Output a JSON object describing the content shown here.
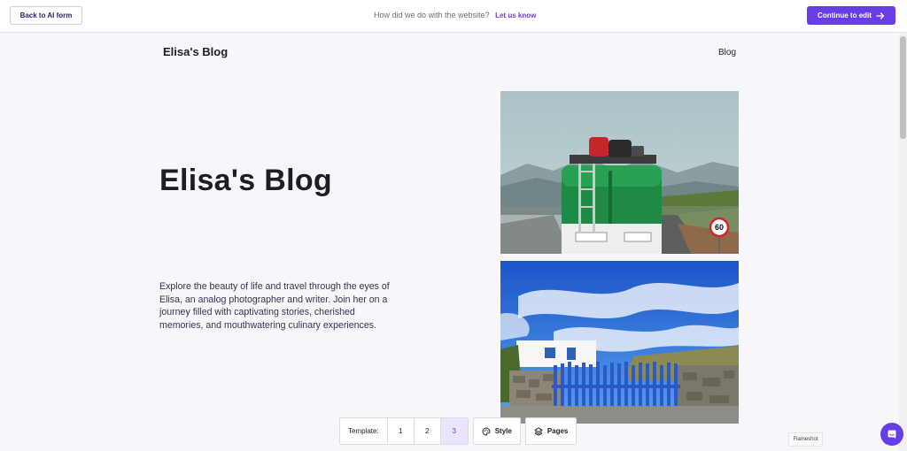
{
  "topbar": {
    "back_label": "Back to AI form",
    "feedback_text": "How did we do with the website?",
    "feedback_link": "Let us know",
    "continue_label": "Continue to edit"
  },
  "site": {
    "logo": "Elisa's Blog",
    "nav_items": [
      "Blog"
    ],
    "hero_title": "Elisa's Blog",
    "hero_text": "Explore the beauty of life and travel through the eyes of Elisa, an analog photographer and writer. Join her on a journey filled with captivating stories, cherished memories, and mouthwatering culinary experiences.",
    "speed_sign": "60"
  },
  "toolbar": {
    "template_label": "Template:",
    "templates": [
      "1",
      "2",
      "3"
    ],
    "active_template": "3",
    "style_label": "Style",
    "pages_label": "Pages"
  },
  "overlay": {
    "flameshot_label": "Flameshot"
  },
  "colors": {
    "accent": "#673de6",
    "page_bg": "#f7f6fb"
  },
  "icons": [
    "arrow-right-icon",
    "palette-icon",
    "layers-icon",
    "chat-icon"
  ]
}
